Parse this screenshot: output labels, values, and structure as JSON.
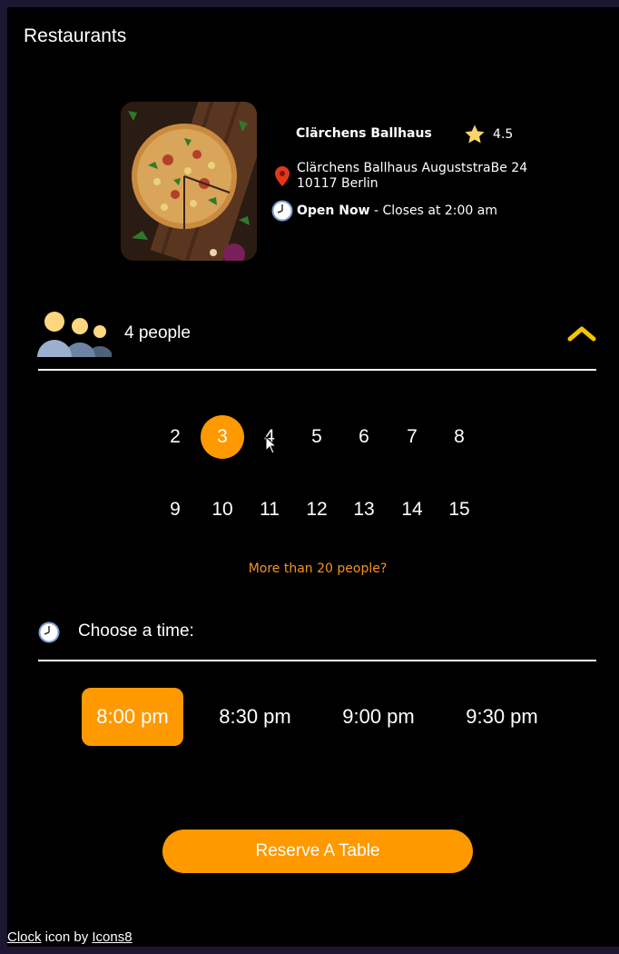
{
  "header": {
    "title": "Restaurants"
  },
  "restaurant": {
    "name": "Clärchens Ballhaus",
    "rating": "4.5",
    "address": "Clärchens Ballhaus AuguststraBe 24 10117 Berlin",
    "open_status": "Open Now",
    "closes_text": " - Closes at 2:00 am"
  },
  "party": {
    "label": "4 people",
    "numbers": [
      "2",
      "3",
      "4",
      "5",
      "6",
      "7",
      "8",
      "9",
      "10",
      "11",
      "12",
      "13",
      "14",
      "15"
    ],
    "selected": "3",
    "more_link": "More than 20 people?"
  },
  "time": {
    "label": "Choose a time:",
    "slots": [
      "8:00 pm",
      "8:30 pm",
      "9:00 pm",
      "9:30 pm"
    ],
    "selected": "8:00 pm"
  },
  "actions": {
    "reserve_label": "Reserve A Table"
  },
  "credit": {
    "clock_link": "Clock",
    "middle_text": " icon by ",
    "icons8_link": "Icons8"
  },
  "colors": {
    "accent": "#ff9900",
    "link": "#f7941d",
    "background": "#000000",
    "star": "#f9d46a",
    "pin": "#e2371c"
  },
  "icons": [
    "star-icon",
    "location-pin-icon",
    "clock-icon",
    "people-icon",
    "chevron-up-icon",
    "cursor-icon"
  ]
}
